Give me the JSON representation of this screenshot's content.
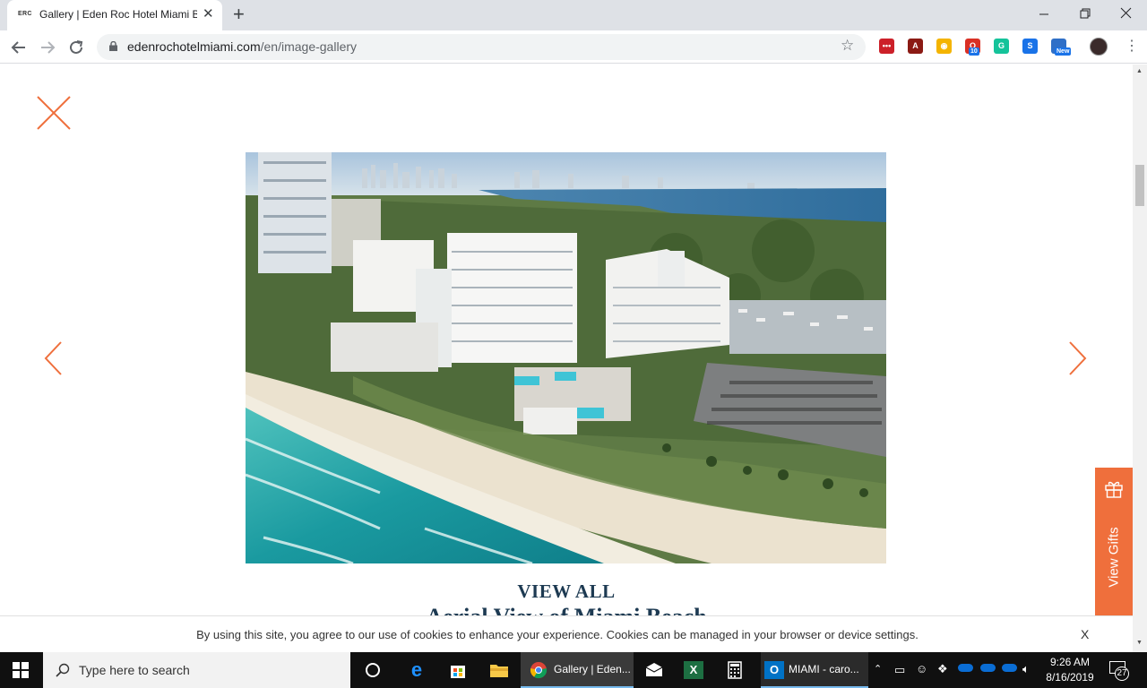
{
  "browser": {
    "tab_favicon": "ERC",
    "tab_title": "Gallery | Eden Roc Hotel Miami B",
    "tab_close": "✕",
    "new_tab": "+",
    "url_host": "edenrochotelmiami.com",
    "url_path": "/en/image-gallery",
    "extensions": [
      {
        "name": "lastpass-icon",
        "color": "#cc2029",
        "text": "•••"
      },
      {
        "name": "acrobat-icon",
        "color": "#8b1a14",
        "text": "A"
      },
      {
        "name": "eye-icon",
        "color": "#f4b400",
        "text": "◉"
      },
      {
        "name": "opera-badge-icon",
        "color": "#d93025",
        "text": "O",
        "badge": "10"
      },
      {
        "name": "grammarly-icon",
        "color": "#15c39a",
        "text": "G"
      },
      {
        "name": "s-extension-icon",
        "color": "#1a73e8",
        "text": "S"
      },
      {
        "name": "new-extension-icon",
        "color": "#2f6fc7",
        "text": "",
        "badge": "New"
      }
    ]
  },
  "page": {
    "view_all": "VIEW ALL",
    "caption": "Aerial View of Miami Beach",
    "gift_label": "View Gifts",
    "cookie_text": "By using this site, you agree to our use of cookies to enhance your experience. Cookies can be managed in your browser or device settings.",
    "cookie_close": "X"
  },
  "taskbar": {
    "search_placeholder": "Type here to search",
    "apps": [
      {
        "name": "chrome-task",
        "label": "Gallery | Eden..."
      },
      {
        "name": "outlook-task",
        "label": "MIAMI - caro..."
      }
    ],
    "time": "9:26 AM",
    "date": "8/16/2019",
    "notification_count": "27"
  },
  "colors": {
    "accent": "#ef6f3c",
    "heading": "#1d3a52"
  }
}
